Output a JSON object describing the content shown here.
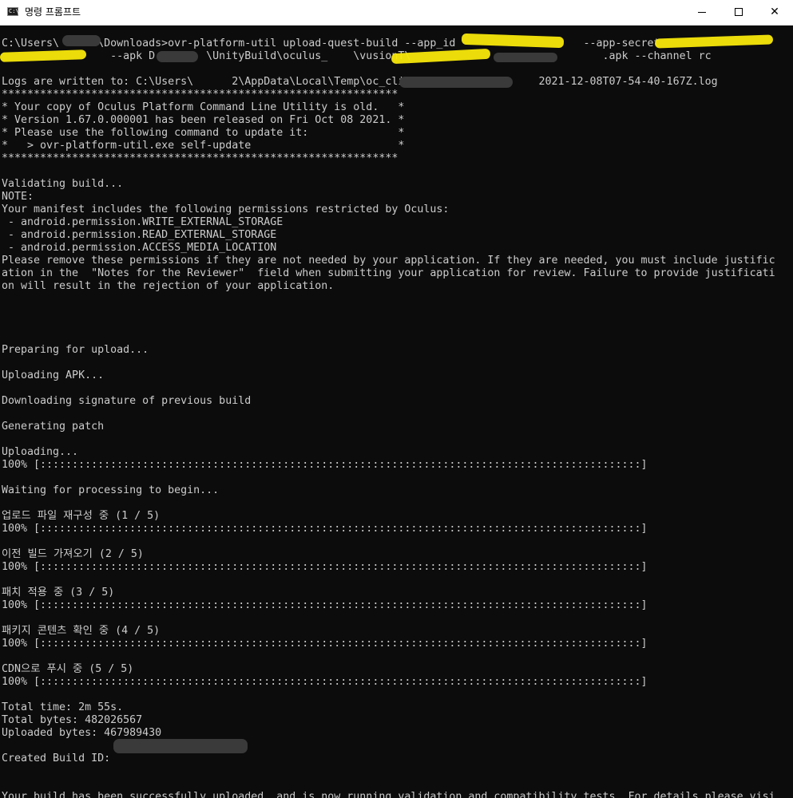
{
  "window": {
    "title": "명령 프롬프트",
    "icon_label": "C:\\",
    "minimize_label": "—",
    "maximize_label": "☐",
    "close_label": "✕"
  },
  "terminal": {
    "lines": [
      "C:\\Users\\      \\Downloads>ovr-platform-util upload-quest-build --app_id                    --app-secret                          ",
      "                 --apk D:\\D     \\UnityBuild\\oculus_    \\vusionT\\                              .apk --channel rc",
      "",
      "Logs are written to: C:\\Users\\      2\\AppData\\Local\\Temp\\oc_cli_                    2021-12-08T07-54-40-167Z.log",
      "**************************************************************",
      "* Your copy of Oculus Platform Command Line Utility is old.   *",
      "* Version 1.67.0.000001 has been released on Fri Oct 08 2021. *",
      "* Please use the following command to update it:              *",
      "*   > ovr-platform-util.exe self-update                       *",
      "**************************************************************",
      "",
      "Validating build...",
      "NOTE:",
      "Your manifest includes the following permissions restricted by Oculus:",
      " - android.permission.WRITE_EXTERNAL_STORAGE",
      " - android.permission.READ_EXTERNAL_STORAGE",
      " - android.permission.ACCESS_MEDIA_LOCATION",
      "Please remove these permissions if they are not needed by your application. If they are needed, you must include justific",
      "ation in the  \"Notes for the Reviewer\"  field when submitting your application for review. Failure to provide justificati",
      "on will result in the rejection of your application.",
      "",
      "",
      "",
      "",
      "Preparing for upload...",
      "",
      "Uploading APK...",
      "",
      "Downloading signature of previous build",
      "",
      "Generating patch",
      "",
      "Uploading...",
      "100% [::::::::::::::::::::::::::::::::::::::::::::::::::::::::::::::::::::::::::::::::::::::::::::::]",
      "",
      "Waiting for processing to begin...",
      "",
      "업로드 파일 재구성 중 (1 / 5)",
      "100% [::::::::::::::::::::::::::::::::::::::::::::::::::::::::::::::::::::::::::::::::::::::::::::::]",
      "",
      "이전 빌드 가져오기 (2 / 5)",
      "100% [::::::::::::::::::::::::::::::::::::::::::::::::::::::::::::::::::::::::::::::::::::::::::::::]",
      "",
      "패치 적용 중 (3 / 5)",
      "100% [::::::::::::::::::::::::::::::::::::::::::::::::::::::::::::::::::::::::::::::::::::::::::::::]",
      "",
      "패키지 콘텐츠 확인 중 (4 / 5)",
      "100% [::::::::::::::::::::::::::::::::::::::::::::::::::::::::::::::::::::::::::::::::::::::::::::::]",
      "",
      "CDN으로 푸시 중 (5 / 5)",
      "100% [::::::::::::::::::::::::::::::::::::::::::::::::::::::::::::::::::::::::::::::::::::::::::::::]",
      "",
      "Total time: 2m 55s.",
      "Total bytes: 482026567",
      "Uploaded bytes: 467989430",
      "",
      "Created Build ID:",
      "",
      "",
      "Your build has been successfully uploaded, and is now running validation and compatibility tests. For details please visi"
    ]
  }
}
